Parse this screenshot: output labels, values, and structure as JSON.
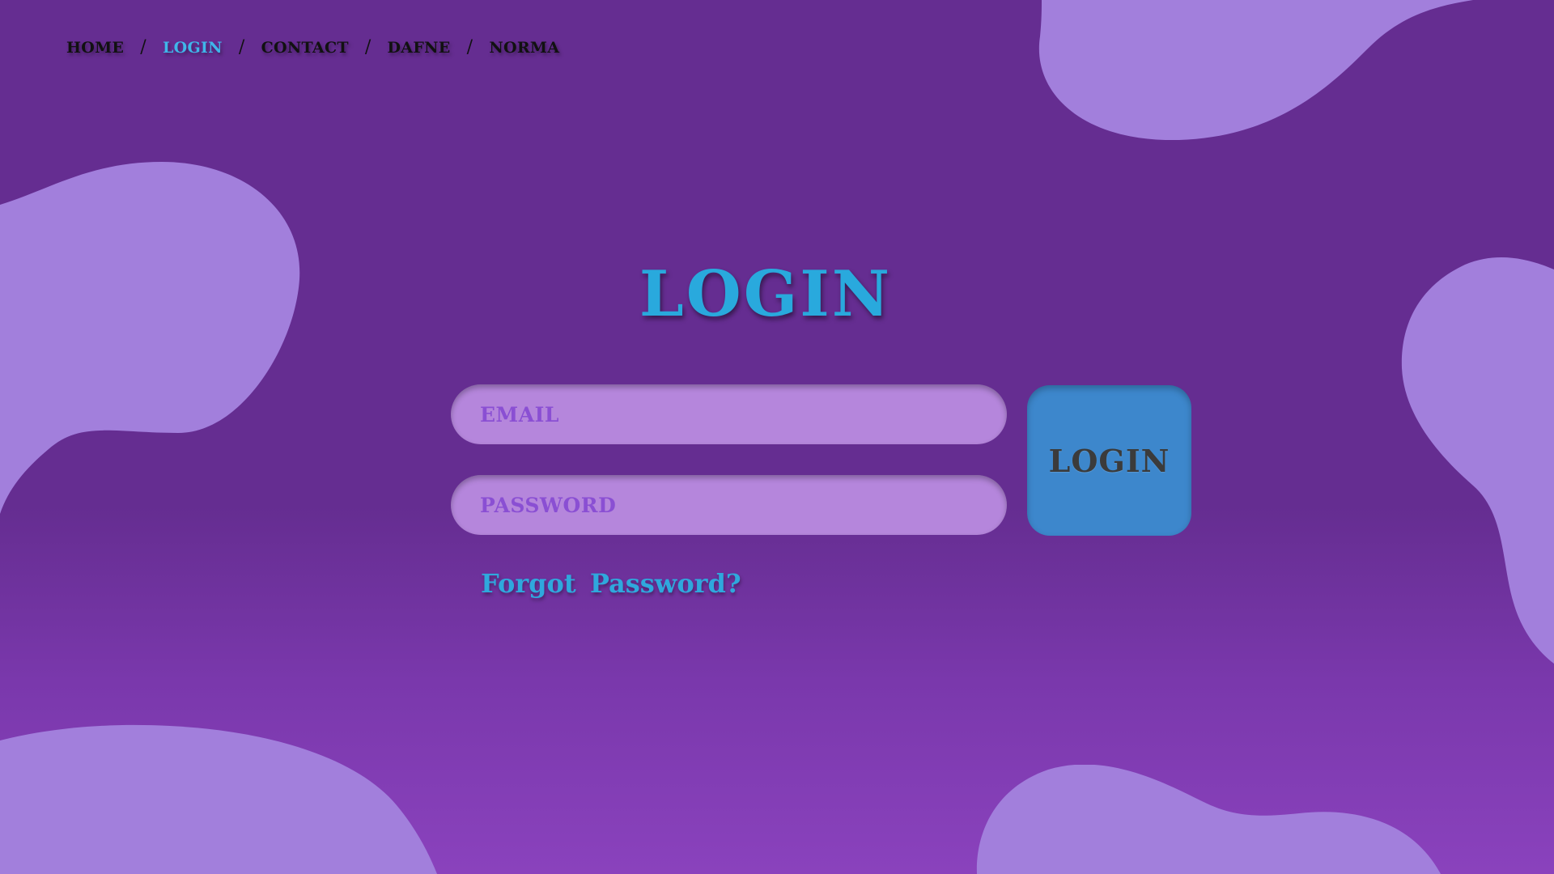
{
  "breadcrumb": {
    "items": [
      {
        "label": "HOME",
        "active": false
      },
      {
        "label": "LOGIN",
        "active": true
      },
      {
        "label": "CONTACT",
        "active": false
      },
      {
        "label": "DAFNE",
        "active": false
      },
      {
        "label": "NORMA",
        "active": false
      }
    ],
    "separator": "/"
  },
  "page": {
    "title": "LOGIN"
  },
  "form": {
    "email_placeholder": "EMAIL",
    "password_placeholder": "PASSWORD",
    "submit_label": "LOGIN",
    "forgot_password_label": "Forgot  Password?"
  },
  "colors": {
    "background": "#652d91",
    "background_bottom": "#8a42bd",
    "blob": "#a27fdc",
    "accent_blue": "#29a9dd",
    "input_fill": "#b586dc",
    "input_text": "#8a4fd3",
    "button_fill": "#3d87cc",
    "button_text": "#3b3b3b"
  }
}
